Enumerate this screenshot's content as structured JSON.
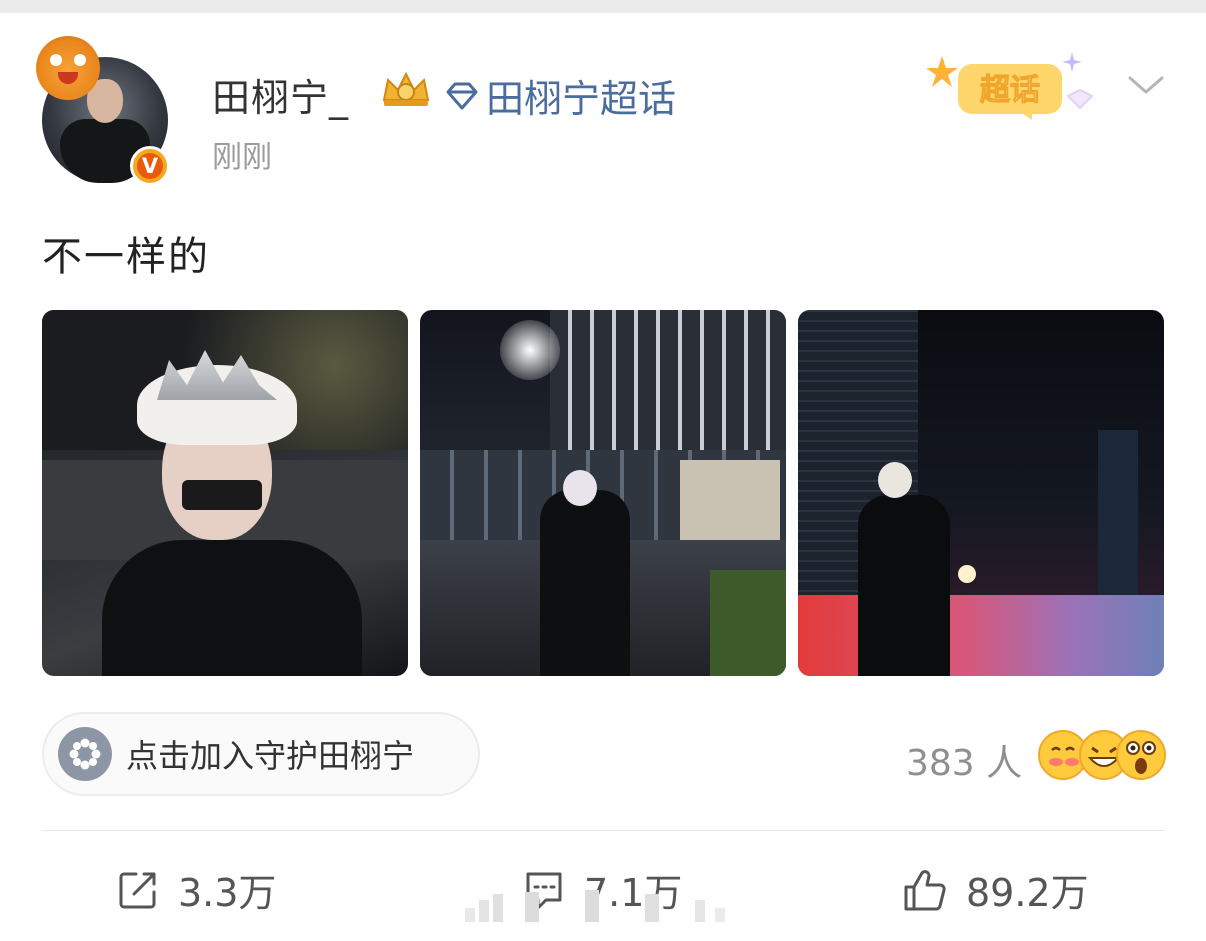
{
  "post": {
    "author": "田栩宁_",
    "supertopic_link": "田栩宁超话",
    "timestamp": "刚刚",
    "text": "不一样的",
    "verified_badge": "V",
    "supertopic_badge_label": "超话"
  },
  "photos": [
    {
      "name": "photo-1"
    },
    {
      "name": "photo-2"
    },
    {
      "name": "photo-3"
    }
  ],
  "guard": {
    "label": "点击加入守护田栩宁",
    "count_label": "383 人"
  },
  "actions": {
    "repost_count": "3.3万",
    "comment_count": "7.1万",
    "like_count": "89.2万"
  },
  "colors": {
    "link": "#4a6d9e",
    "timestamp": "#9b9b9b",
    "badge_orange": "#f4a81d",
    "pill_icon": "#8e96a5"
  },
  "icons": [
    "crown-icon",
    "diamond-icon",
    "chevron-down-icon",
    "pinwheel-icon",
    "repost-icon",
    "comment-icon",
    "like-icon",
    "emoji-icon"
  ]
}
